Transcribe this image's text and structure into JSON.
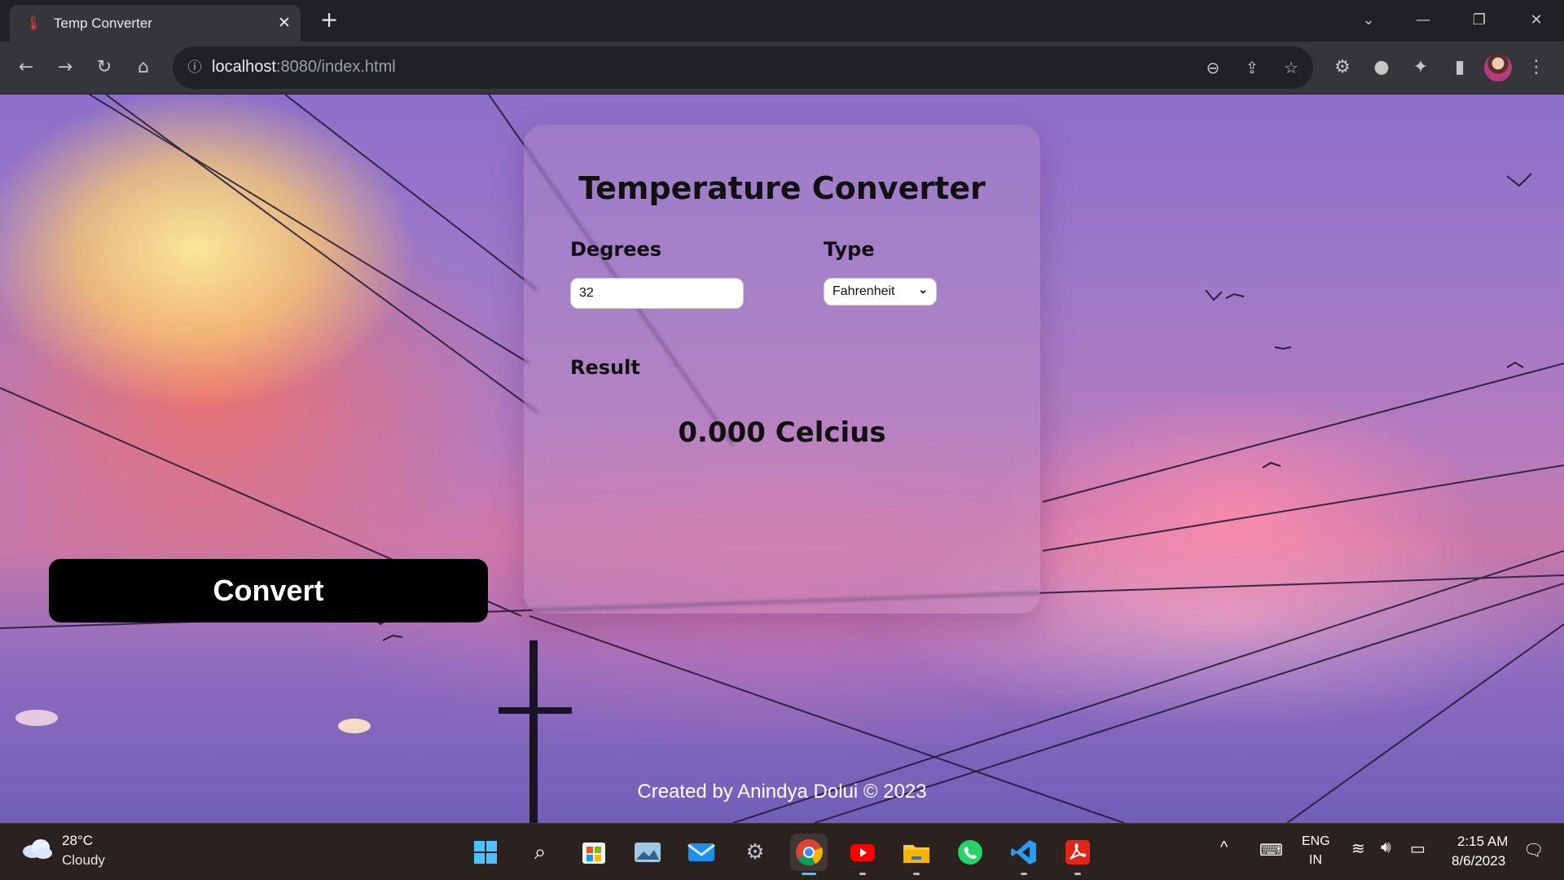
{
  "browser": {
    "tab_title": "Temp Converter",
    "tab_close": "✕",
    "new_tab": "+",
    "url_host": "localhost",
    "url_path": ":8080/index.html"
  },
  "page": {
    "title": "Temperature Converter",
    "degrees_label": "Degrees",
    "degrees_value": "32",
    "type_label": "Type",
    "type_selected": "Fahrenheit",
    "result_label": "Result",
    "result_value": "0.000 Celcius",
    "convert_label": "Convert",
    "footer": "Created by Anindya Dolui © 2023"
  },
  "taskbar": {
    "weather_temp": "28°C",
    "weather_desc": "Cloudy",
    "lang_top": "ENG",
    "lang_bottom": "IN",
    "time": "2:15 AM",
    "date": "8/6/2023",
    "apps": [
      "start-icon",
      "search-icon",
      "store-icon",
      "photos-icon",
      "mail-icon",
      "settings-icon",
      "chrome-icon",
      "youtube-icon",
      "file-explorer-icon",
      "whatsapp-icon",
      "vscode-icon",
      "acrobat-icon"
    ]
  },
  "colors": {
    "chrome_dark": "#202124",
    "chrome_toolbar": "#35363a",
    "button_bg": "#000000",
    "taskbar_bg": "#2b211f",
    "active_indicator": "#4cc2ff"
  }
}
